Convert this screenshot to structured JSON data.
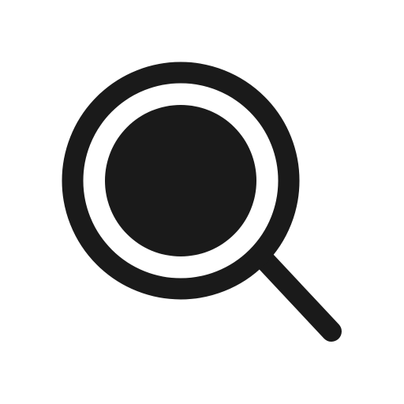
{
  "icon": {
    "name": "search-icon",
    "variant": "magnifying-glass-filled-center"
  },
  "colors": {
    "background": "#ffffff",
    "foreground": "#1a1a1a"
  }
}
